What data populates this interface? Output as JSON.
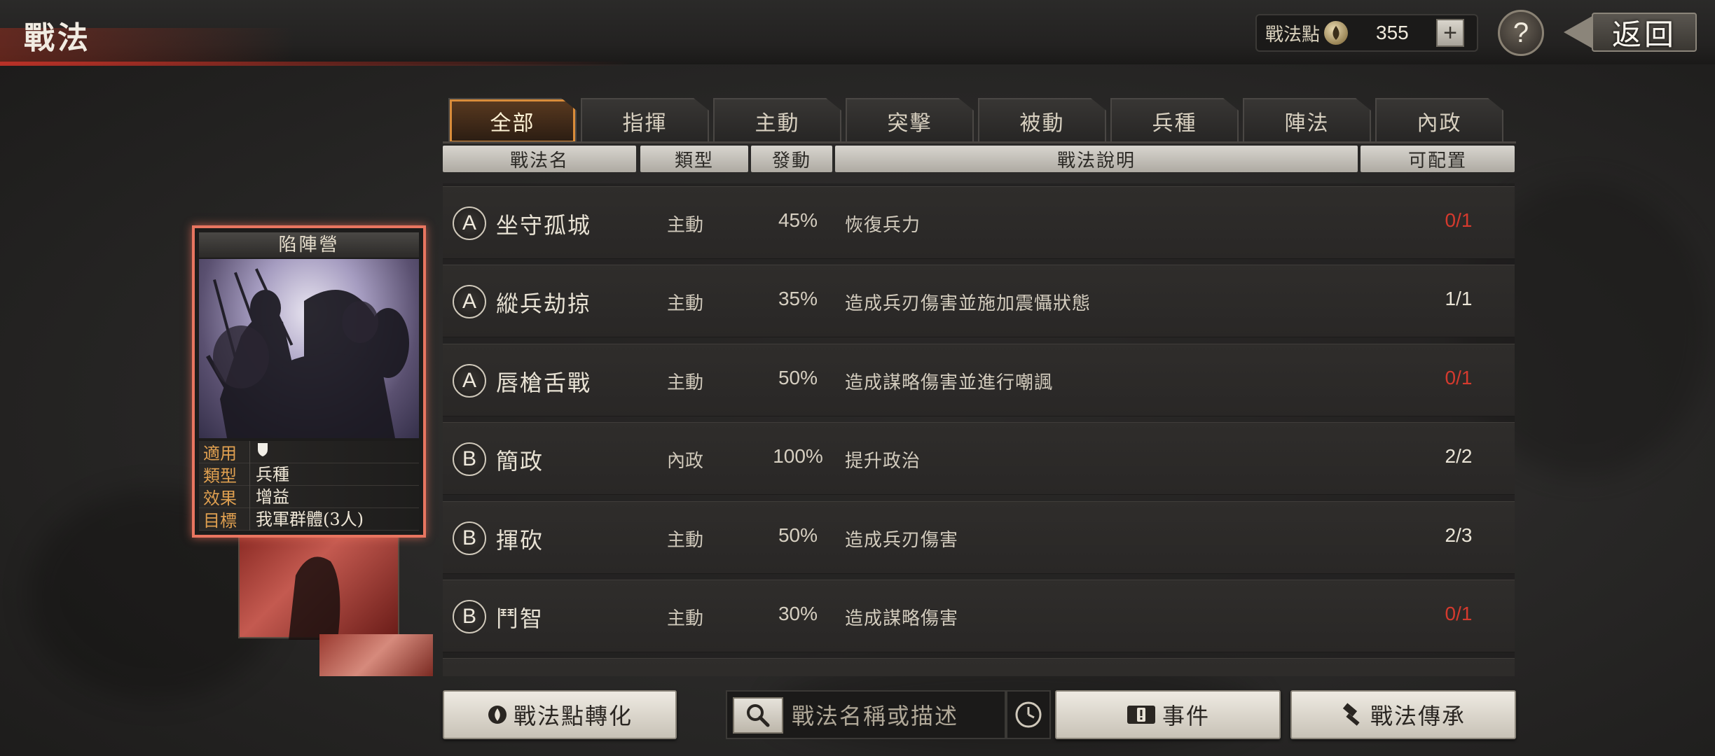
{
  "header": {
    "title": "戰法",
    "points_label": "戰法點",
    "points_value": "355",
    "plus_label": "+",
    "help_label": "?",
    "back_label": "返回"
  },
  "tabs": [
    {
      "label": "全部",
      "active": true
    },
    {
      "label": "指揮"
    },
    {
      "label": "主動"
    },
    {
      "label": "突擊"
    },
    {
      "label": "被動"
    },
    {
      "label": "兵種"
    },
    {
      "label": "陣法"
    },
    {
      "label": "內政"
    }
  ],
  "columns": {
    "name": "戰法名",
    "type": "類型",
    "rate": "發動",
    "desc": "戰法說明",
    "avail": "可配置"
  },
  "tactics": [
    {
      "grade": "A",
      "name": "坐守孤城",
      "type": "主動",
      "rate": "45%",
      "desc": "恢復兵力",
      "avail": "0/1",
      "red": true
    },
    {
      "grade": "A",
      "name": "縱兵劫掠",
      "type": "主動",
      "rate": "35%",
      "desc": "造成兵刃傷害並施加震懾狀態",
      "avail": "1/1",
      "red": false
    },
    {
      "grade": "A",
      "name": "唇槍舌戰",
      "type": "主動",
      "rate": "50%",
      "desc": "造成謀略傷害並進行嘲諷",
      "avail": "0/1",
      "red": true
    },
    {
      "grade": "B",
      "name": "簡政",
      "type": "內政",
      "rate": "100%",
      "desc": "提升政治",
      "avail": "2/2",
      "red": false
    },
    {
      "grade": "B",
      "name": "揮砍",
      "type": "主動",
      "rate": "50%",
      "desc": "造成兵刃傷害",
      "avail": "2/3",
      "red": false
    },
    {
      "grade": "B",
      "name": "鬥智",
      "type": "主動",
      "rate": "30%",
      "desc": "造成謀略傷害",
      "avail": "0/1",
      "red": true
    }
  ],
  "card": {
    "title": "陷陣營",
    "info": [
      {
        "key": "適用",
        "value": ""
      },
      {
        "key": "類型",
        "value": "兵種"
      },
      {
        "key": "效果",
        "value": "增益"
      },
      {
        "key": "目標",
        "value": "我軍群體(3人)"
      }
    ]
  },
  "bottom": {
    "convert_label": "戰法點轉化",
    "search_placeholder": "戰法名稱或描述",
    "events_label": "事件",
    "inherit_label": "戰法傳承"
  },
  "colors": {
    "accent_orange": "#d98c3a",
    "unavailable_red": "#d43a2e",
    "card_border": "#e87560"
  }
}
